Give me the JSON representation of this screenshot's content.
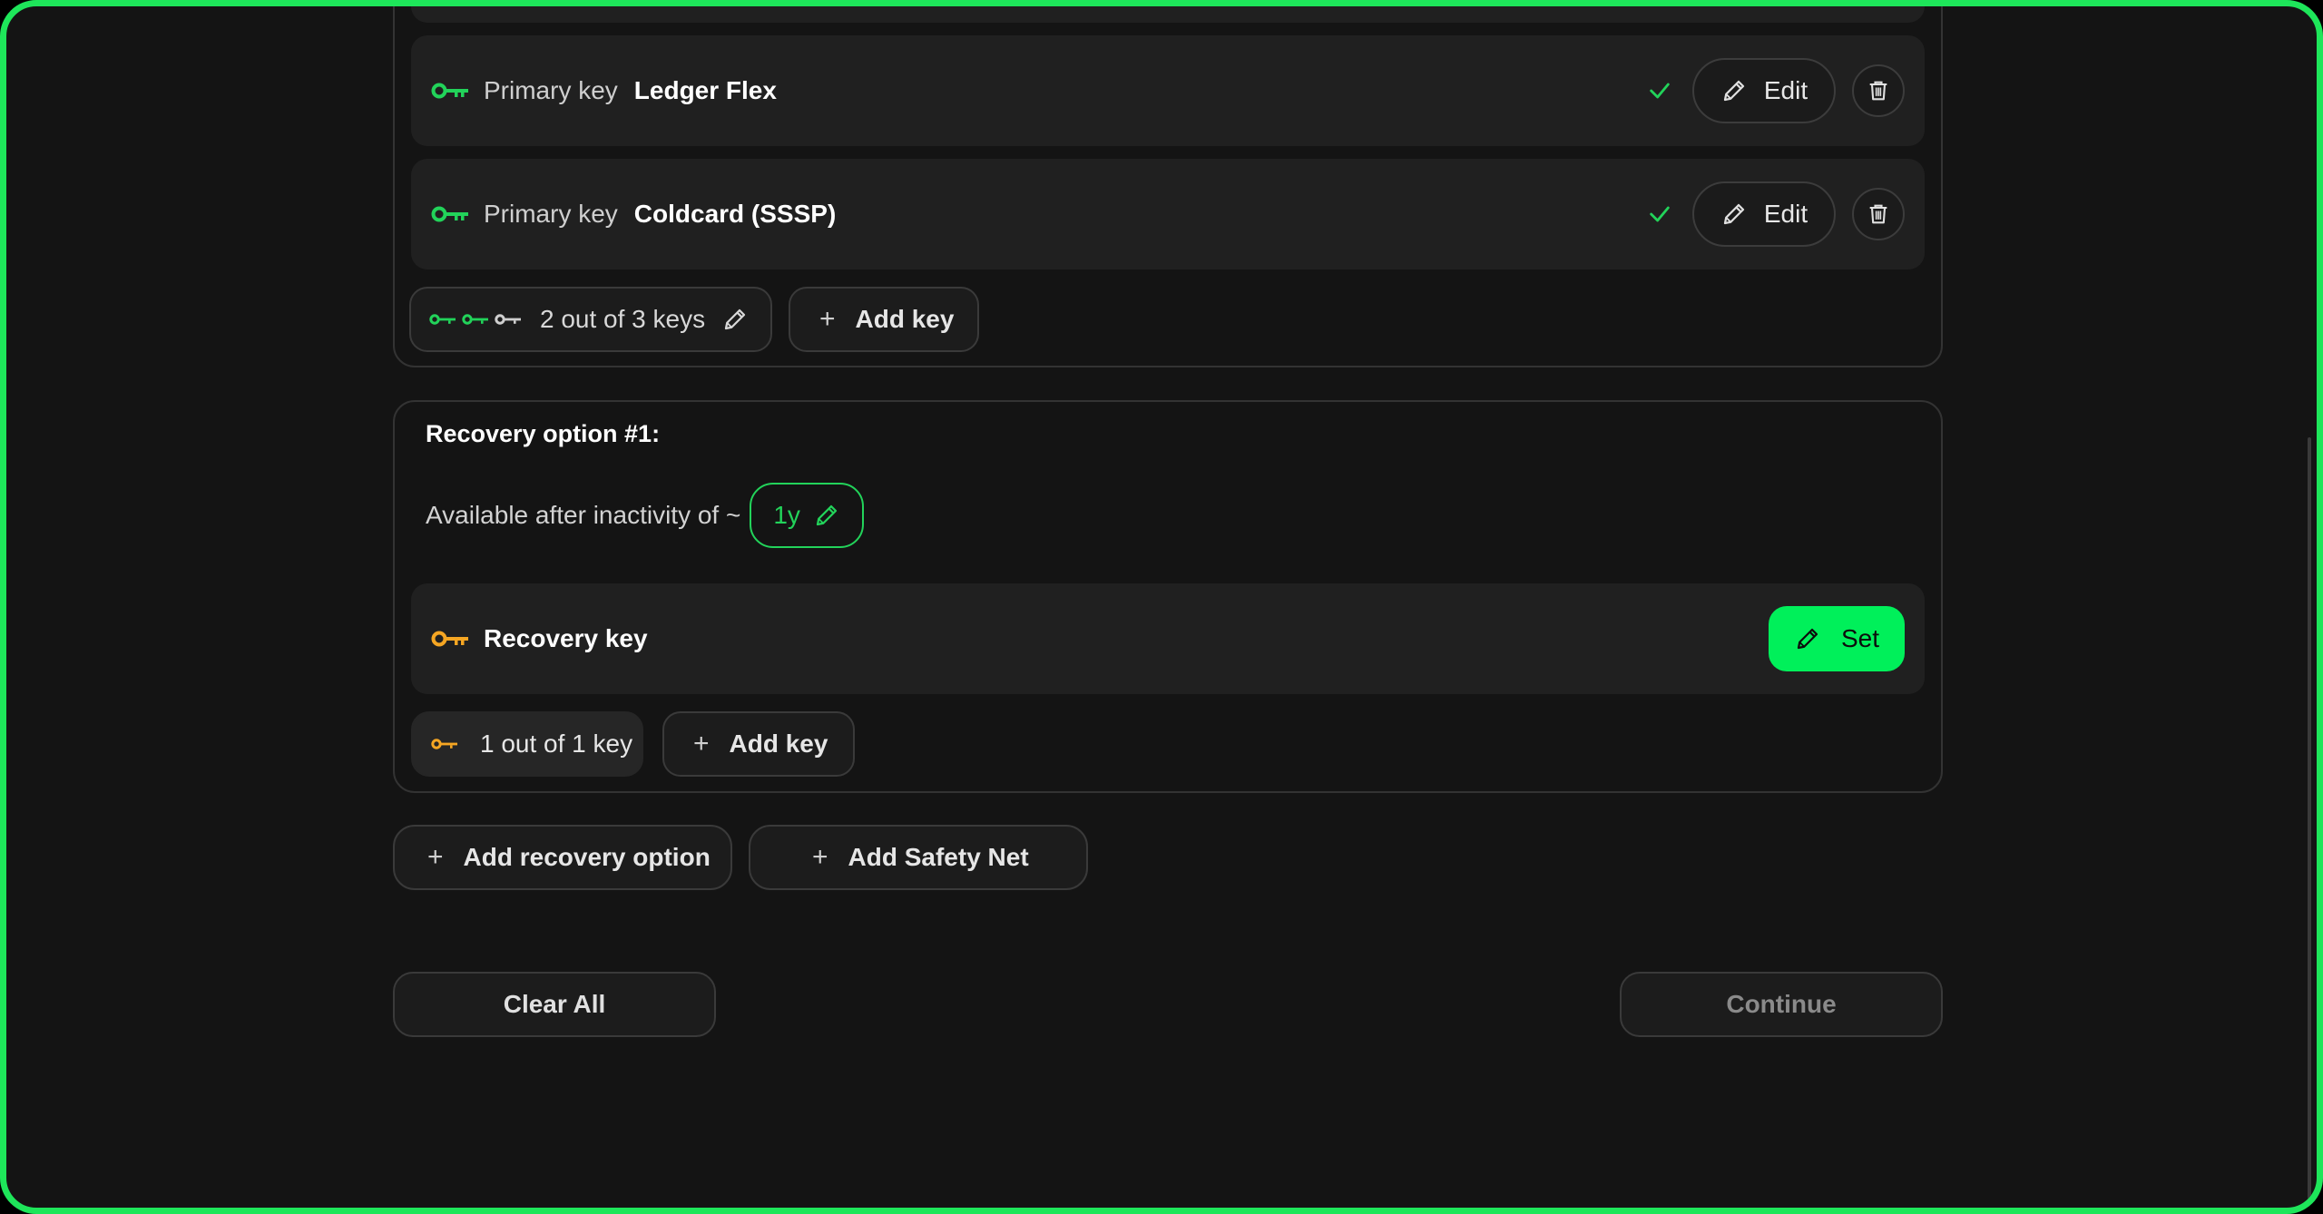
{
  "theme": {
    "accent": "#00f05a",
    "primary_key_color": "#22d35a",
    "recovery_key_color": "#f5a623",
    "background": "#141414"
  },
  "primary_keys": [
    {
      "kind": "Primary key",
      "name": "Ledger Flex",
      "status_icon": "check-icon",
      "edit_label": "Edit"
    },
    {
      "kind": "Primary key",
      "name": "Coldcard (SSSP)",
      "status_icon": "check-icon",
      "edit_label": "Edit"
    }
  ],
  "primary_threshold": {
    "label": "2 out of 3 keys",
    "icons": [
      "key-icon-green",
      "key-icon-green",
      "key-icon-gray"
    ]
  },
  "primary_add_key_label": "Add key",
  "recovery": {
    "title": "Recovery option #1:",
    "inactivity_label": "Available after inactivity of ~",
    "inactivity_value": "1y",
    "key_label": "Recovery key",
    "set_label": "Set",
    "threshold_label": "1 out of 1 key",
    "add_key_label": "Add key"
  },
  "actions": {
    "add_recovery_option": "Add recovery option",
    "add_safety_net": "Add Safety Net",
    "clear_all": "Clear All",
    "continue": "Continue"
  }
}
